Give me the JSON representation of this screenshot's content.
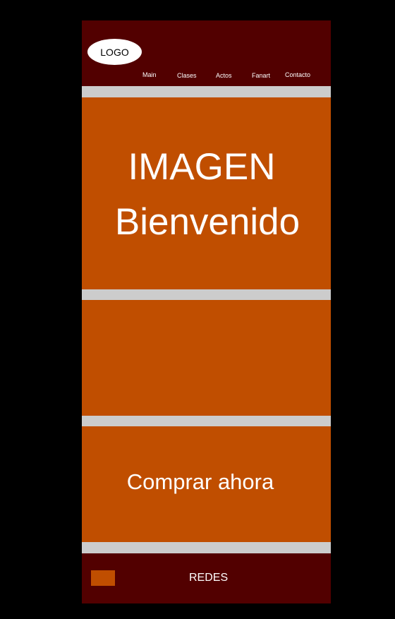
{
  "header": {
    "logo": "LOGO",
    "nav": [
      "Main",
      "Clases",
      "Actos",
      "Fanart",
      "Contacto"
    ]
  },
  "hero": {
    "line1": "IMAGEN",
    "line2": "Bienvenido"
  },
  "cta": {
    "label": "Comprar ahora"
  },
  "footer": {
    "label": "REDES"
  },
  "colors": {
    "page_background": "#000000",
    "header_footer": "#520000",
    "panel": "#c04e00",
    "divider": "#cccccc",
    "text": "#ffffff"
  }
}
